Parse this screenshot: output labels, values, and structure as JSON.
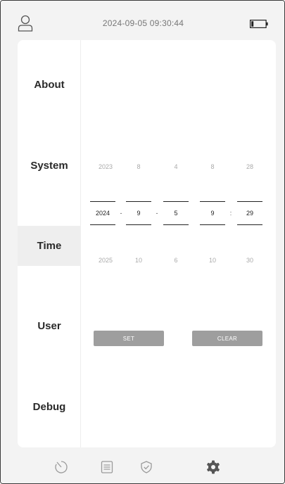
{
  "status_bar": {
    "datetime": "2024-09-05  09:30:44",
    "user_icon": "user-icon",
    "battery_icon": "battery-icon"
  },
  "sidebar": {
    "items": [
      {
        "label": "About"
      },
      {
        "label": "System"
      },
      {
        "label": "Time",
        "active": true
      },
      {
        "label": "User"
      },
      {
        "label": "Debug"
      }
    ]
  },
  "time_picker": {
    "prev_row": [
      "2023",
      "8",
      "4",
      "8",
      "28"
    ],
    "current_row": [
      "2024",
      "9",
      "5",
      "9",
      "29"
    ],
    "next_row": [
      "2025",
      "10",
      "6",
      "10",
      "30"
    ],
    "separators": [
      "-",
      "-",
      ":"
    ]
  },
  "actions": {
    "set_label": "SET",
    "clear_label": "CLEAR"
  },
  "bottom_nav": {
    "icons": [
      "timer-icon",
      "list-icon",
      "shield-icon",
      "settings-icon"
    ],
    "active_color": "#555555",
    "inactive_color": "#9a9a9a"
  }
}
